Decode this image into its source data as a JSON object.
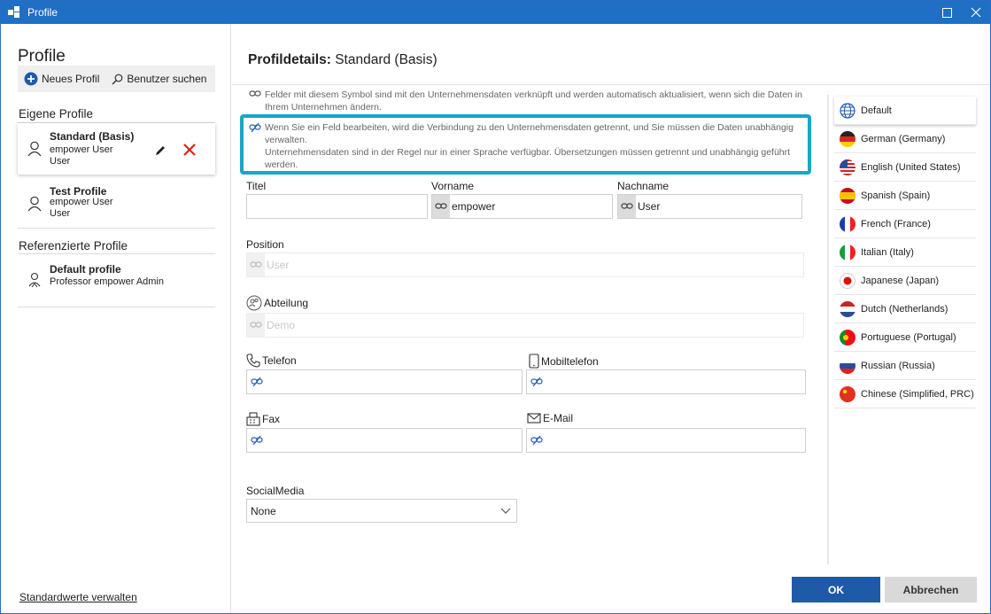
{
  "window": {
    "title": "Profile"
  },
  "left": {
    "heading": "Profile",
    "new_profile": "Neues Profil",
    "search_user": "Benutzer suchen",
    "own_profiles_title": "Eigene Profile",
    "own_profiles": [
      {
        "name": "Standard (Basis)",
        "line1": "empower User",
        "line2": "User"
      },
      {
        "name": "Test Profile",
        "line1": "empower User",
        "line2": "User"
      }
    ],
    "ref_profiles_title": "Referenzierte Profile",
    "ref_profiles": [
      {
        "name": "Default profile",
        "line1": "Professor empower Admin"
      }
    ],
    "manage_defaults": "Standardwerte verwalten"
  },
  "main": {
    "title_bold": "Profildetails:",
    "title_rest": "Standard (Basis)",
    "info1": "Felder mit diesem Symbol sind mit den Unternehmensdaten verknüpft und werden automatisch aktualisiert, wenn sich die Daten in Ihrem Unternehmen ändern.",
    "info2a": "Wenn Sie ein Feld bearbeiten, wird die Verbindung zu den Unternehmensdaten getrennt, und Sie müssen die Daten unabhängig verwalten.",
    "info2b": "Unternehmensdaten sind in der Regel nur in einer Sprache verfügbar. Übersetzungen müssen getrennt und unabhängig geführt werden.",
    "fields": {
      "titel": {
        "label": "Titel",
        "value": ""
      },
      "vorname": {
        "label": "Vorname",
        "value": "empower"
      },
      "nachname": {
        "label": "Nachname",
        "value": "User"
      },
      "position": {
        "label": "Position",
        "value": "User"
      },
      "abteilung": {
        "label": "Abteilung",
        "value": "Demo"
      },
      "telefon": {
        "label": "Telefon",
        "value": ""
      },
      "mobil": {
        "label": "Mobiltelefon",
        "value": ""
      },
      "fax": {
        "label": "Fax",
        "value": ""
      },
      "email": {
        "label": "E-Mail",
        "value": ""
      },
      "social": {
        "label": "SocialMedia",
        "value": "None"
      }
    },
    "ok": "OK",
    "cancel": "Abbrechen"
  },
  "languages": [
    {
      "label": "Default",
      "icon": "globe-icon"
    },
    {
      "label": "German (Germany)",
      "icon": "flag-germany-icon"
    },
    {
      "label": "English (United States)",
      "icon": "flag-usa-icon"
    },
    {
      "label": "Spanish (Spain)",
      "icon": "flag-spain-icon"
    },
    {
      "label": "French (France)",
      "icon": "flag-france-icon"
    },
    {
      "label": "Italian (Italy)",
      "icon": "flag-italy-icon"
    },
    {
      "label": "Japanese (Japan)",
      "icon": "flag-japan-icon"
    },
    {
      "label": "Dutch (Netherlands)",
      "icon": "flag-netherlands-icon"
    },
    {
      "label": "Portuguese (Portugal)",
      "icon": "flag-portugal-icon"
    },
    {
      "label": "Russian (Russia)",
      "icon": "flag-russia-icon"
    },
    {
      "label": "Chinese (Simplified, PRC)",
      "icon": "flag-china-icon"
    }
  ],
  "colors": {
    "titlebar": "#1f6fc5",
    "accent": "#1f5aa8",
    "highlight": "#1aa4c8",
    "delete": "#e02020"
  }
}
